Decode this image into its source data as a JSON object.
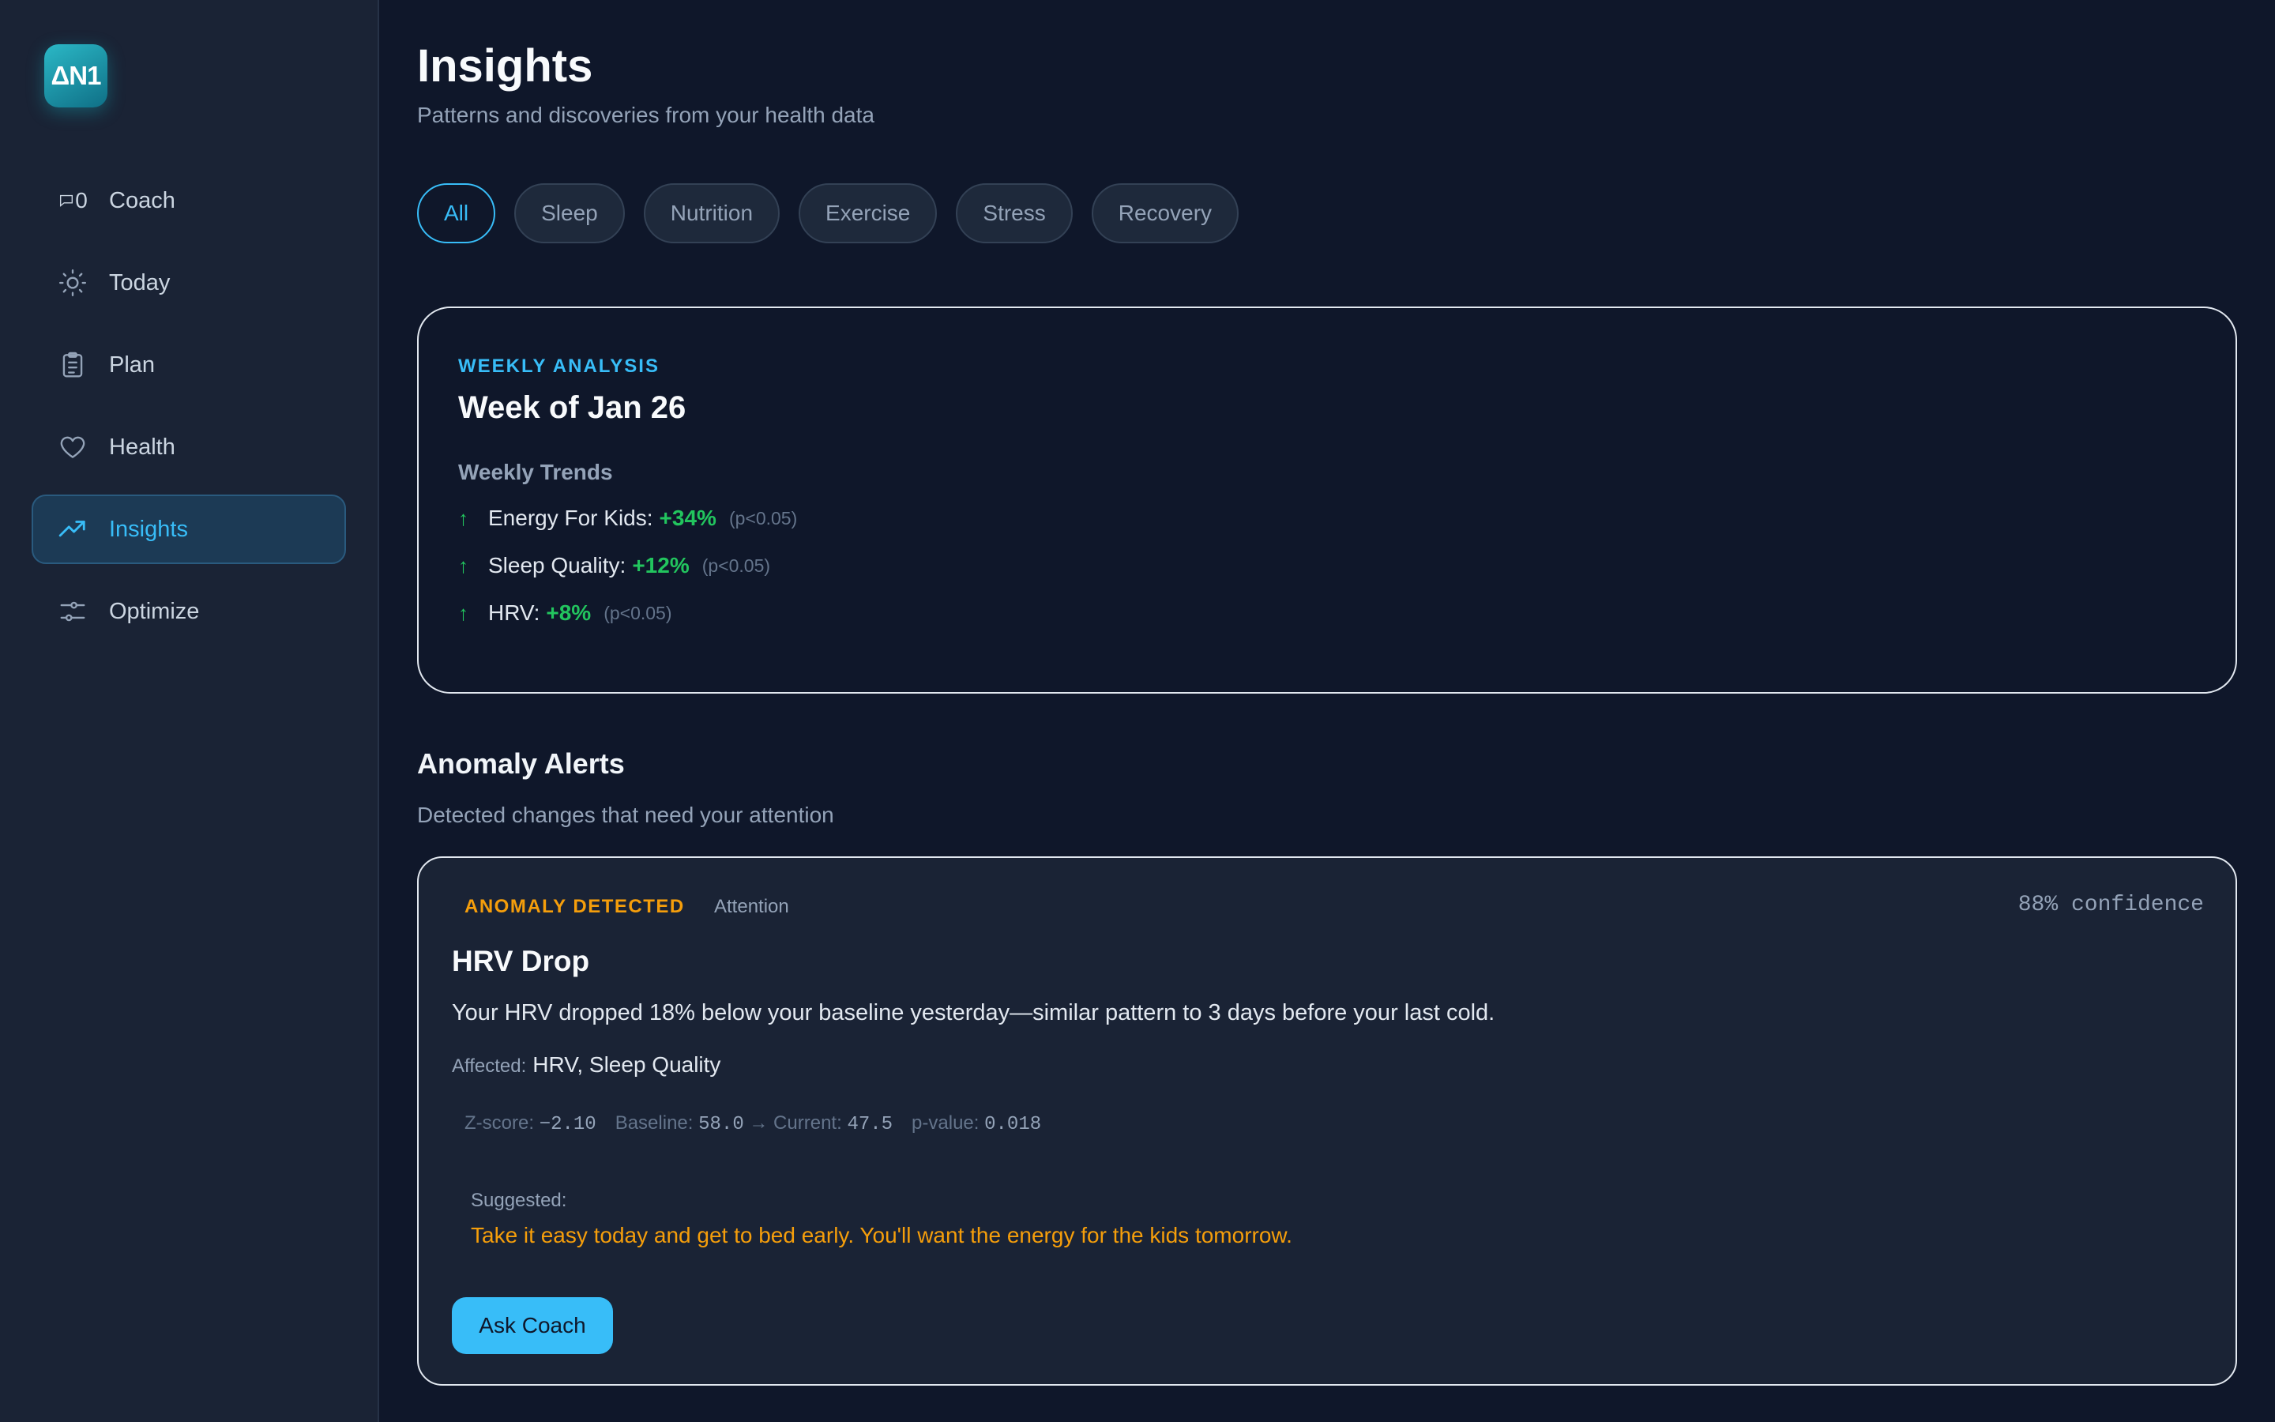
{
  "app": {
    "logo_text": "ΔN1"
  },
  "sidebar": {
    "items": [
      {
        "label": "Coach",
        "icon": "chat-bubble-icon",
        "badge": "0"
      },
      {
        "label": "Today",
        "icon": "sun-icon"
      },
      {
        "label": "Plan",
        "icon": "clipboard-icon"
      },
      {
        "label": "Health",
        "icon": "heart-icon"
      },
      {
        "label": "Insights",
        "icon": "trending-up-icon",
        "active": true
      },
      {
        "label": "Optimize",
        "icon": "sliders-icon"
      }
    ]
  },
  "header": {
    "title": "Insights",
    "subtitle": "Patterns and discoveries from your health data"
  },
  "filters": [
    "All",
    "Sleep",
    "Nutrition",
    "Exercise",
    "Stress",
    "Recovery"
  ],
  "weekly": {
    "eyebrow": "WEEKLY ANALYSIS",
    "title": "Week of Jan 26",
    "trends_heading": "Weekly Trends",
    "trends": [
      {
        "label": "Energy For Kids:",
        "value": "+34%",
        "p": "(p<0.05)"
      },
      {
        "label": "Sleep Quality:",
        "value": "+12%",
        "p": "(p<0.05)"
      },
      {
        "label": "HRV:",
        "value": "+8%",
        "p": "(p<0.05)"
      }
    ]
  },
  "anomaly_section": {
    "title": "Anomaly Alerts",
    "subtitle": "Detected changes that need your attention"
  },
  "anomaly": {
    "tag": "ANOMALY DETECTED",
    "severity": "Attention",
    "confidence": "88% confidence",
    "title": "HRV Drop",
    "description": "Your HRV dropped 18% below your baseline yesterday—similar pattern to 3 days before your last cold.",
    "affected_label": "Affected:",
    "affected_values": "HRV, Sleep Quality",
    "zscore_label": "Z-score:",
    "zscore_value": "−2.10",
    "baseline_label": "Baseline:",
    "baseline_value": "58.0",
    "current_label": "→ Current:",
    "current_value": "47.5",
    "pvalue_label": "p-value:",
    "pvalue_value": "0.018",
    "suggested_label": "Suggested:",
    "suggested_text": "Take it easy today and get to bed early. You'll want the energy for the kids tomorrow.",
    "button": "Ask Coach"
  },
  "colors": {
    "background": "#0f172a",
    "sidebar": "#1a2335",
    "accent": "#38bdf8",
    "positive": "#22c55e",
    "warning": "#f59e0b"
  }
}
